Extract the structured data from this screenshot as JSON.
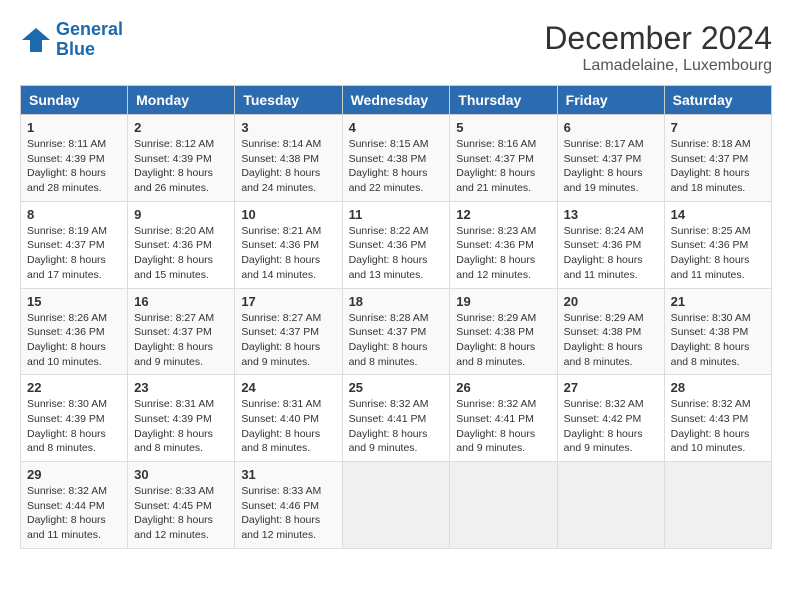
{
  "header": {
    "logo_line1": "General",
    "logo_line2": "Blue",
    "month": "December 2024",
    "location": "Lamadelaine, Luxembourg"
  },
  "days_of_week": [
    "Sunday",
    "Monday",
    "Tuesday",
    "Wednesday",
    "Thursday",
    "Friday",
    "Saturday"
  ],
  "weeks": [
    [
      {
        "day": "1",
        "sunrise": "8:11 AM",
        "sunset": "4:39 PM",
        "daylight": "8 hours and 28 minutes."
      },
      {
        "day": "2",
        "sunrise": "8:12 AM",
        "sunset": "4:39 PM",
        "daylight": "8 hours and 26 minutes."
      },
      {
        "day": "3",
        "sunrise": "8:14 AM",
        "sunset": "4:38 PM",
        "daylight": "8 hours and 24 minutes."
      },
      {
        "day": "4",
        "sunrise": "8:15 AM",
        "sunset": "4:38 PM",
        "daylight": "8 hours and 22 minutes."
      },
      {
        "day": "5",
        "sunrise": "8:16 AM",
        "sunset": "4:37 PM",
        "daylight": "8 hours and 21 minutes."
      },
      {
        "day": "6",
        "sunrise": "8:17 AM",
        "sunset": "4:37 PM",
        "daylight": "8 hours and 19 minutes."
      },
      {
        "day": "7",
        "sunrise": "8:18 AM",
        "sunset": "4:37 PM",
        "daylight": "8 hours and 18 minutes."
      }
    ],
    [
      {
        "day": "8",
        "sunrise": "8:19 AM",
        "sunset": "4:37 PM",
        "daylight": "8 hours and 17 minutes."
      },
      {
        "day": "9",
        "sunrise": "8:20 AM",
        "sunset": "4:36 PM",
        "daylight": "8 hours and 15 minutes."
      },
      {
        "day": "10",
        "sunrise": "8:21 AM",
        "sunset": "4:36 PM",
        "daylight": "8 hours and 14 minutes."
      },
      {
        "day": "11",
        "sunrise": "8:22 AM",
        "sunset": "4:36 PM",
        "daylight": "8 hours and 13 minutes."
      },
      {
        "day": "12",
        "sunrise": "8:23 AM",
        "sunset": "4:36 PM",
        "daylight": "8 hours and 12 minutes."
      },
      {
        "day": "13",
        "sunrise": "8:24 AM",
        "sunset": "4:36 PM",
        "daylight": "8 hours and 11 minutes."
      },
      {
        "day": "14",
        "sunrise": "8:25 AM",
        "sunset": "4:36 PM",
        "daylight": "8 hours and 11 minutes."
      }
    ],
    [
      {
        "day": "15",
        "sunrise": "8:26 AM",
        "sunset": "4:36 PM",
        "daylight": "8 hours and 10 minutes."
      },
      {
        "day": "16",
        "sunrise": "8:27 AM",
        "sunset": "4:37 PM",
        "daylight": "8 hours and 9 minutes."
      },
      {
        "day": "17",
        "sunrise": "8:27 AM",
        "sunset": "4:37 PM",
        "daylight": "8 hours and 9 minutes."
      },
      {
        "day": "18",
        "sunrise": "8:28 AM",
        "sunset": "4:37 PM",
        "daylight": "8 hours and 8 minutes."
      },
      {
        "day": "19",
        "sunrise": "8:29 AM",
        "sunset": "4:38 PM",
        "daylight": "8 hours and 8 minutes."
      },
      {
        "day": "20",
        "sunrise": "8:29 AM",
        "sunset": "4:38 PM",
        "daylight": "8 hours and 8 minutes."
      },
      {
        "day": "21",
        "sunrise": "8:30 AM",
        "sunset": "4:38 PM",
        "daylight": "8 hours and 8 minutes."
      }
    ],
    [
      {
        "day": "22",
        "sunrise": "8:30 AM",
        "sunset": "4:39 PM",
        "daylight": "8 hours and 8 minutes."
      },
      {
        "day": "23",
        "sunrise": "8:31 AM",
        "sunset": "4:39 PM",
        "daylight": "8 hours and 8 minutes."
      },
      {
        "day": "24",
        "sunrise": "8:31 AM",
        "sunset": "4:40 PM",
        "daylight": "8 hours and 8 minutes."
      },
      {
        "day": "25",
        "sunrise": "8:32 AM",
        "sunset": "4:41 PM",
        "daylight": "8 hours and 9 minutes."
      },
      {
        "day": "26",
        "sunrise": "8:32 AM",
        "sunset": "4:41 PM",
        "daylight": "8 hours and 9 minutes."
      },
      {
        "day": "27",
        "sunrise": "8:32 AM",
        "sunset": "4:42 PM",
        "daylight": "8 hours and 9 minutes."
      },
      {
        "day": "28",
        "sunrise": "8:32 AM",
        "sunset": "4:43 PM",
        "daylight": "8 hours and 10 minutes."
      }
    ],
    [
      {
        "day": "29",
        "sunrise": "8:32 AM",
        "sunset": "4:44 PM",
        "daylight": "8 hours and 11 minutes."
      },
      {
        "day": "30",
        "sunrise": "8:33 AM",
        "sunset": "4:45 PM",
        "daylight": "8 hours and 12 minutes."
      },
      {
        "day": "31",
        "sunrise": "8:33 AM",
        "sunset": "4:46 PM",
        "daylight": "8 hours and 12 minutes."
      },
      null,
      null,
      null,
      null
    ]
  ]
}
